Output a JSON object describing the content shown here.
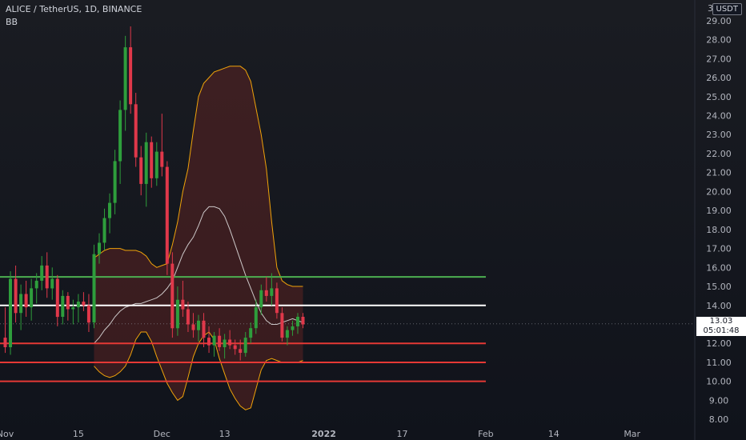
{
  "header": {
    "symbol_line": "ALICE / TetherUS, 1D, BINANCE",
    "indicator": "BB",
    "currency": "USDT",
    "top_tick": "3"
  },
  "price_tag": {
    "price": "13.03",
    "countdown": "05:01:48"
  },
  "colors": {
    "up": "#26a69a",
    "up_bright": "#2e9e3c",
    "down": "#e0384a",
    "band": "#f0a30a",
    "basis": "#e6e6e6",
    "hl_green": "#4caf50",
    "hl_white": "#ffffff",
    "hl_red": "#e53935",
    "fill": "#6a2624"
  },
  "chart_data": {
    "type": "candlestick",
    "title": "ALICE / TetherUS, 1D, BINANCE",
    "ylim": [
      7.5,
      29.5
    ],
    "y_ticks": [
      8,
      9,
      10,
      11,
      12,
      13,
      14,
      15,
      16,
      17,
      18,
      19,
      20,
      21,
      22,
      23,
      24,
      25,
      26,
      27,
      28,
      29
    ],
    "x_ticks": [
      {
        "label": "Nov",
        "day": 0
      },
      {
        "label": "15",
        "day": 14
      },
      {
        "label": "Dec",
        "day": 30
      },
      {
        "label": "13",
        "day": 42
      },
      {
        "label": "2022",
        "day": 61
      },
      {
        "label": "17",
        "day": 76
      },
      {
        "label": "Feb",
        "day": 92
      },
      {
        "label": "14",
        "day": 105
      },
      {
        "label": "Mar",
        "day": 120
      }
    ],
    "xlim": [
      -1,
      132
    ],
    "candles": [
      [
        12.3,
        13.9,
        11.5,
        11.8
      ],
      [
        11.8,
        15.8,
        11.4,
        15.4
      ],
      [
        15.4,
        16.1,
        13.1,
        13.6
      ],
      [
        13.6,
        15.1,
        12.7,
        14.6
      ],
      [
        14.6,
        15.3,
        13.4,
        13.9
      ],
      [
        13.9,
        15.4,
        13.2,
        14.9
      ],
      [
        14.9,
        15.7,
        14.1,
        15.3
      ],
      [
        15.3,
        16.6,
        14.8,
        16.1
      ],
      [
        16.1,
        16.8,
        14.4,
        14.9
      ],
      [
        14.9,
        16.0,
        14.3,
        15.4
      ],
      [
        15.4,
        15.6,
        12.9,
        13.4
      ],
      [
        13.4,
        14.8,
        13.0,
        14.5
      ],
      [
        14.5,
        14.7,
        13.2,
        13.8
      ],
      [
        13.8,
        14.3,
        13.0,
        13.9
      ],
      [
        13.9,
        14.6,
        13.1,
        14.2
      ],
      [
        14.2,
        14.7,
        13.7,
        14.0
      ],
      [
        14.0,
        14.6,
        12.6,
        13.1
      ],
      [
        13.1,
        17.2,
        12.8,
        16.7
      ],
      [
        16.7,
        17.8,
        16.2,
        17.3
      ],
      [
        17.3,
        19.1,
        16.9,
        18.6
      ],
      [
        18.6,
        19.9,
        17.8,
        19.4
      ],
      [
        19.4,
        22.2,
        18.8,
        21.6
      ],
      [
        21.6,
        24.8,
        20.4,
        24.3
      ],
      [
        24.3,
        28.2,
        23.2,
        27.6
      ],
      [
        27.6,
        28.7,
        24.1,
        24.6
      ],
      [
        24.6,
        25.2,
        21.3,
        21.8
      ],
      [
        21.8,
        22.4,
        19.8,
        20.4
      ],
      [
        20.4,
        23.1,
        19.2,
        22.6
      ],
      [
        22.6,
        22.9,
        20.2,
        20.7
      ],
      [
        20.7,
        22.6,
        20.3,
        22.1
      ],
      [
        22.1,
        24.1,
        20.8,
        21.3
      ],
      [
        21.3,
        21.6,
        15.6,
        16.2
      ],
      [
        16.2,
        16.8,
        12.3,
        12.8
      ],
      [
        12.8,
        15.0,
        12.4,
        14.3
      ],
      [
        14.3,
        15.3,
        13.4,
        13.8
      ],
      [
        13.8,
        14.2,
        12.6,
        13.0
      ],
      [
        13.0,
        13.6,
        12.3,
        12.7
      ],
      [
        12.7,
        13.5,
        12.1,
        13.2
      ],
      [
        13.2,
        13.6,
        11.8,
        12.3
      ],
      [
        12.3,
        12.9,
        11.5,
        11.9
      ],
      [
        11.9,
        12.6,
        11.3,
        12.4
      ],
      [
        12.4,
        12.8,
        11.6,
        11.8
      ],
      [
        11.8,
        12.5,
        11.2,
        12.2
      ],
      [
        12.2,
        12.7,
        11.7,
        11.9
      ],
      [
        11.9,
        12.2,
        11.4,
        11.7
      ],
      [
        11.7,
        12.2,
        11.1,
        11.5
      ],
      [
        11.5,
        12.6,
        11.3,
        12.3
      ],
      [
        12.3,
        13.1,
        12.0,
        12.8
      ],
      [
        12.8,
        14.3,
        12.5,
        13.9
      ],
      [
        13.9,
        15.1,
        13.5,
        14.8
      ],
      [
        14.8,
        15.5,
        14.2,
        14.5
      ],
      [
        14.5,
        15.7,
        14.0,
        14.9
      ],
      [
        14.9,
        15.2,
        13.3,
        13.6
      ],
      [
        13.6,
        13.9,
        12.1,
        12.3
      ],
      [
        12.3,
        12.9,
        11.9,
        12.7
      ],
      [
        12.7,
        13.2,
        12.4,
        12.9
      ],
      [
        12.9,
        13.6,
        12.5,
        13.4
      ],
      [
        13.4,
        13.6,
        12.8,
        13.0
      ]
    ],
    "bollinger": {
      "upper": [
        16.5,
        16.7,
        16.9,
        17.0,
        17.0,
        17.0,
        16.9,
        16.9,
        16.9,
        16.8,
        16.6,
        16.2,
        16.0,
        16.1,
        16.2,
        17.2,
        18.4,
        20.0,
        21.2,
        23.2,
        25.0,
        25.7,
        26.0,
        26.3,
        26.4,
        26.5,
        26.6,
        26.6,
        26.6,
        26.4,
        25.8,
        24.4,
        23.0,
        21.2,
        18.4,
        16.0,
        15.3,
        15.1,
        15.0,
        15.0,
        15.0
      ],
      "basis": [
        12.0,
        12.3,
        12.7,
        13.0,
        13.4,
        13.7,
        13.9,
        14.0,
        14.1,
        14.1,
        14.2,
        14.3,
        14.4,
        14.6,
        14.9,
        15.3,
        16.0,
        16.7,
        17.2,
        17.6,
        18.2,
        18.9,
        19.2,
        19.2,
        19.1,
        18.7,
        18.0,
        17.2,
        16.4,
        15.6,
        14.9,
        14.2,
        13.6,
        13.2,
        13.0,
        13.0,
        13.1,
        13.2,
        13.3,
        13.2,
        13.1
      ],
      "lower": [
        10.8,
        10.5,
        10.3,
        10.2,
        10.3,
        10.5,
        10.8,
        11.4,
        12.2,
        12.6,
        12.6,
        12.1,
        11.3,
        10.6,
        9.9,
        9.4,
        9.0,
        9.2,
        10.2,
        11.3,
        12.0,
        12.4,
        12.6,
        12.2,
        11.2,
        10.4,
        9.6,
        9.1,
        8.7,
        8.5,
        8.6,
        9.6,
        10.6,
        11.1,
        11.2,
        11.1,
        11.0,
        11.0,
        11.0,
        11.0,
        11.1
      ],
      "start_day": 17
    },
    "hlines": [
      {
        "value": 15.5,
        "color": "green"
      },
      {
        "value": 14.0,
        "color": "white"
      },
      {
        "value": 12.0,
        "color": "red"
      },
      {
        "value": 11.0,
        "color": "red"
      },
      {
        "value": 10.0,
        "color": "red"
      }
    ],
    "last_price": 13.03
  }
}
